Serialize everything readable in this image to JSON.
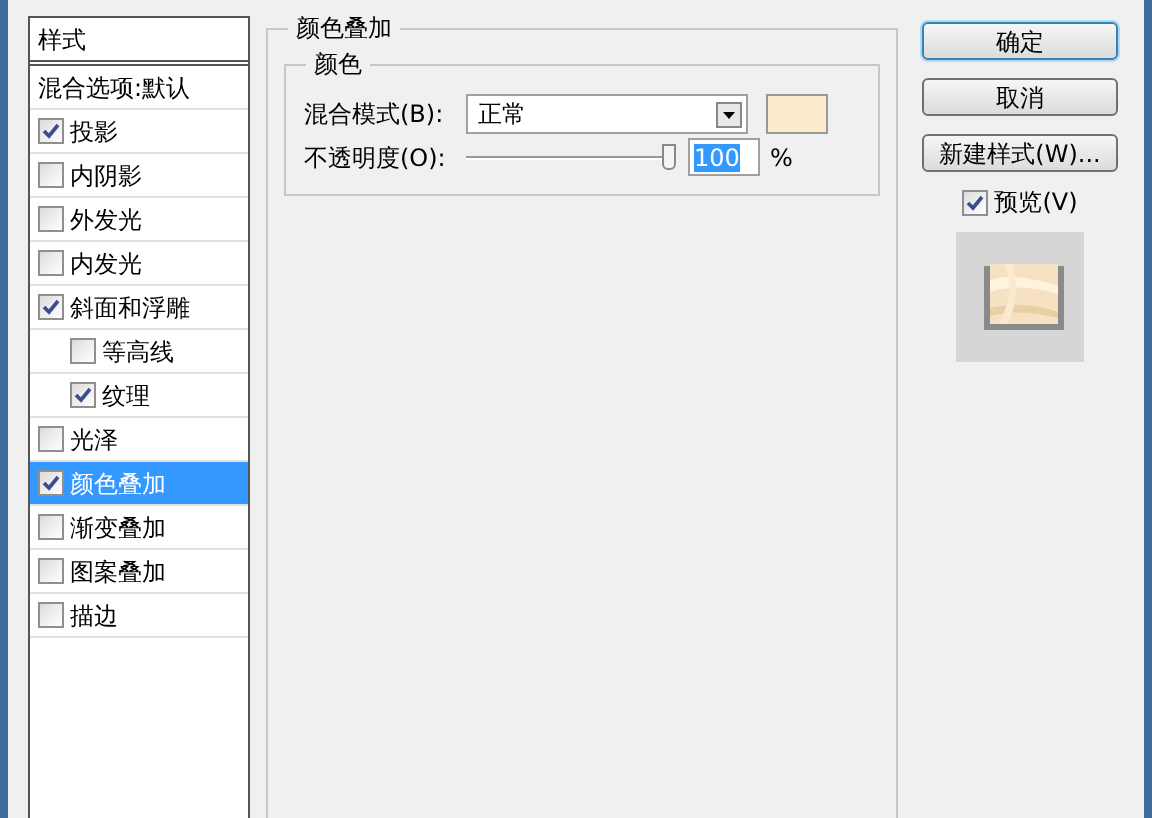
{
  "sidebar": {
    "header": "样式",
    "items": [
      {
        "label": "混合选项:默认",
        "kind": "plain",
        "selected": false
      },
      {
        "label": "投影",
        "kind": "check",
        "checked": true,
        "selected": false
      },
      {
        "label": "内阴影",
        "kind": "check",
        "checked": false,
        "selected": false
      },
      {
        "label": "外发光",
        "kind": "check",
        "checked": false,
        "selected": false
      },
      {
        "label": "内发光",
        "kind": "check",
        "checked": false,
        "selected": false
      },
      {
        "label": "斜面和浮雕",
        "kind": "check",
        "checked": true,
        "selected": false,
        "children": [
          {
            "label": "等高线",
            "kind": "check",
            "checked": false,
            "selected": false
          },
          {
            "label": "纹理",
            "kind": "check",
            "checked": true,
            "selected": false
          }
        ]
      },
      {
        "label": "光泽",
        "kind": "check",
        "checked": false,
        "selected": false
      },
      {
        "label": "颜色叠加",
        "kind": "check",
        "checked": true,
        "selected": true
      },
      {
        "label": "渐变叠加",
        "kind": "check",
        "checked": false,
        "selected": false
      },
      {
        "label": "图案叠加",
        "kind": "check",
        "checked": false,
        "selected": false
      },
      {
        "label": "描边",
        "kind": "check",
        "checked": false,
        "selected": false
      }
    ]
  },
  "panel": {
    "title": "颜色叠加",
    "group": {
      "title": "颜色",
      "blend_mode": {
        "label": "混合模式(B):",
        "value": "正常",
        "color": "#fdeccb"
      },
      "opacity": {
        "label": "不透明度(O):",
        "level": 0.98,
        "value": "100",
        "unit": "%"
      }
    }
  },
  "buttons": [
    {
      "label": "确定",
      "default": true
    },
    {
      "label": "取消",
      "default": false
    },
    {
      "label": "新建样式(W)...",
      "default": false
    }
  ],
  "preview": {
    "label": "预览(V)",
    "checked": true
  }
}
